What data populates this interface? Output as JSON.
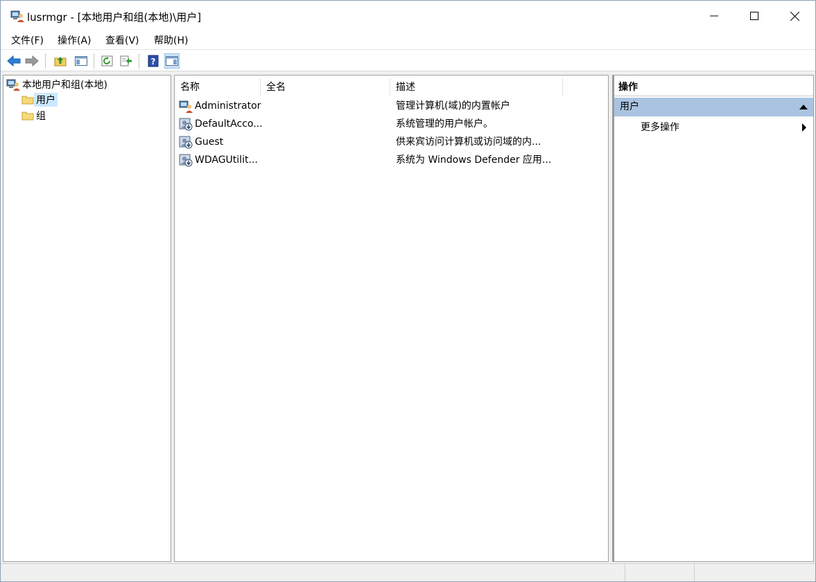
{
  "window": {
    "title": "lusrmgr - [本地用户和组(本地)\\用户]"
  },
  "menu": [
    "文件(F)",
    "操作(A)",
    "查看(V)",
    "帮助(H)"
  ],
  "toolbar": {
    "buttons": [
      "back",
      "forward",
      "up-one-level",
      "show-hide-console-tree",
      "refresh",
      "export-list",
      "help",
      "show-hide-action-pane"
    ]
  },
  "tree": {
    "root": "本地用户和组(本地)",
    "children": [
      "用户",
      "组"
    ],
    "selected": "用户"
  },
  "list": {
    "columns": [
      "名称",
      "全名",
      "描述"
    ],
    "rows": [
      {
        "name": "Administrator",
        "fullname": "",
        "description": "管理计算机(域)的内置帐户"
      },
      {
        "name": "DefaultAcco...",
        "fullname": "",
        "description": "系统管理的用户帐户。"
      },
      {
        "name": "Guest",
        "fullname": "",
        "description": "供来宾访问计算机或访问域的内..."
      },
      {
        "name": "WDAGUtilit...",
        "fullname": "",
        "description": "系统为 Windows Defender 应用..."
      }
    ]
  },
  "actions": {
    "title": "操作",
    "section": "用户",
    "items": [
      "更多操作"
    ]
  },
  "colors": {
    "selection": "#cce8ff",
    "action_section": "#a9c3e1",
    "back_arrow": "#2e7ed6"
  }
}
